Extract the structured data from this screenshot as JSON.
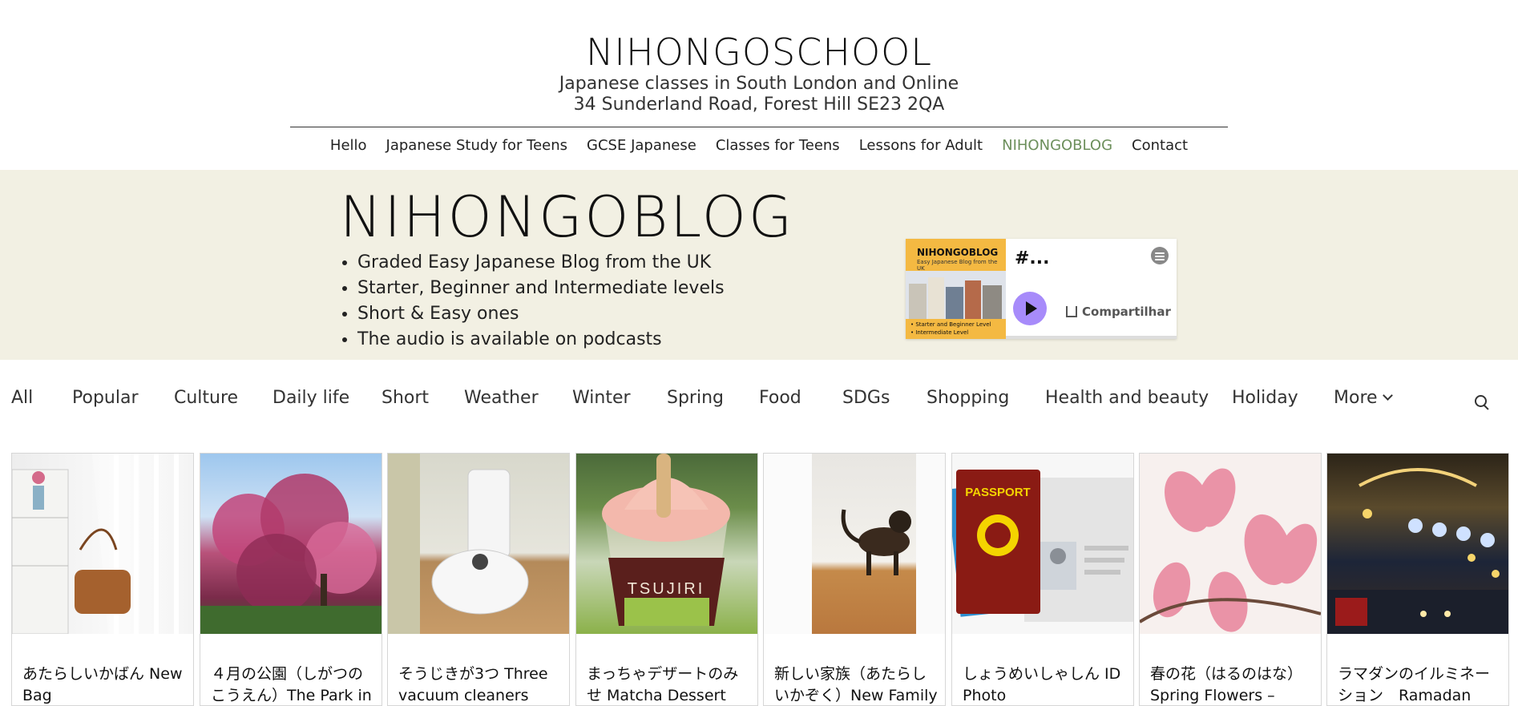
{
  "header": {
    "site_title": "NIHONGOSCHOOL",
    "subtitle_1": "Japanese classes in South London and Online",
    "subtitle_2": "34 Sunderland Road, Forest Hill SE23 2QA"
  },
  "nav": {
    "items": [
      {
        "label": "Hello"
      },
      {
        "label": "Japanese Study for Teens"
      },
      {
        "label": "GCSE Japanese"
      },
      {
        "label": "Classes for Teens"
      },
      {
        "label": "Lessons for Adult"
      },
      {
        "label": "NIHONGOBLOG",
        "active": true
      },
      {
        "label": "Contact"
      }
    ],
    "active_color": "#6c8f5b"
  },
  "hero": {
    "title": "NIHONGOBLOG",
    "bullets": [
      "Graded Easy Japanese Blog from the UK",
      "Starter, Beginner and Intermediate levels",
      "Short & Easy ones",
      "The audio is available on podcasts"
    ],
    "background_color": "#f2f0e3"
  },
  "podcast_player": {
    "art_title": "NIHONGOBLOG",
    "art_subtitle": "Easy Japanese Blog from the UK",
    "art_note_1": "• Starter and Beginner Level",
    "art_note_2": "• Intermediate Level",
    "episode_title": "#...",
    "share_label": "Compartilhar",
    "logo_icon": "spotify-icon",
    "play_icon": "play-icon",
    "accent_color": "#a78bfa"
  },
  "categories": {
    "items": [
      "All",
      "Popular",
      "Culture",
      "Daily life",
      "Short",
      "Weather",
      "Winter",
      "Spring",
      "Food",
      "SDGs",
      "Shopping",
      "Health and beauty",
      "Holiday"
    ],
    "more_label": "More",
    "search_icon": "search-icon"
  },
  "posts": [
    {
      "title": "あたらしいかばん New Bag"
    },
    {
      "title": "４月の公園（しがつのこうえん）The Park in"
    },
    {
      "title": "そうじきが3つ Three vacuum cleaners"
    },
    {
      "title": "まっちゃデザートのみせ Matcha Dessert"
    },
    {
      "title": "新しい家族（あたらしいかぞく）New Family"
    },
    {
      "title": "しょうめいしゃしん ID Photo"
    },
    {
      "title": "春の花（はるのはな） Spring Flowers –"
    },
    {
      "title": "ラマダンのイルミネーション　Ramadan"
    }
  ],
  "post_images": {
    "passport_label": "PASSPORT",
    "cup_label": "TSUJIRI"
  }
}
